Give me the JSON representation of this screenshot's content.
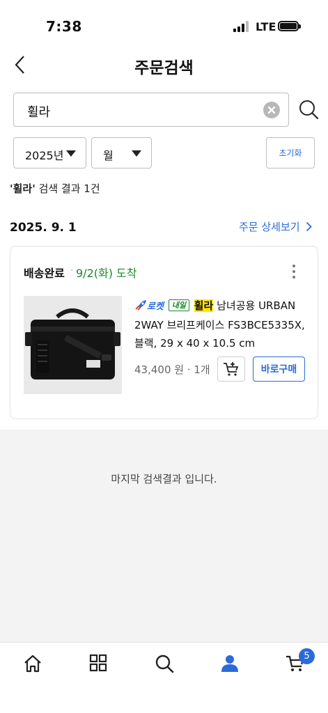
{
  "status_bar": {
    "time": "7:38",
    "network": "LTE"
  },
  "header": {
    "title": "주문검색"
  },
  "search": {
    "value": "휠라"
  },
  "filters": {
    "year": "2025년",
    "month": "월",
    "reset_label": "초기화"
  },
  "result_summary": {
    "keyword": "'휠라'",
    "text": " 검색 결과 1건"
  },
  "order": {
    "date": "2025. 9. 1",
    "detail_link": "주문 상세보기",
    "status": "배송완료",
    "separator": "·",
    "delivery_date": "9/2(화) 도착",
    "product": {
      "rocket_label": "로켓",
      "naeil_badge": "내일",
      "brand_highlight": "휠라",
      "title_rest": " 남녀공용 URBAN 2WAY 브리프케이스 FS3BCE5335X, 블랙, 29 x 40 x 10.5 cm",
      "price": "43,400 원",
      "price_sep": " · ",
      "quantity": "1개",
      "buy_now_label": "바로구매"
    }
  },
  "end_message": "마지막 검색결과 입니다.",
  "tab_bar": {
    "cart_count": "5",
    "accent_color": "#2b6bd9"
  },
  "colors": {
    "link_blue": "#2b6bd9",
    "delivery_green": "#1a8a2a",
    "highlight_yellow": "#ffe600"
  }
}
